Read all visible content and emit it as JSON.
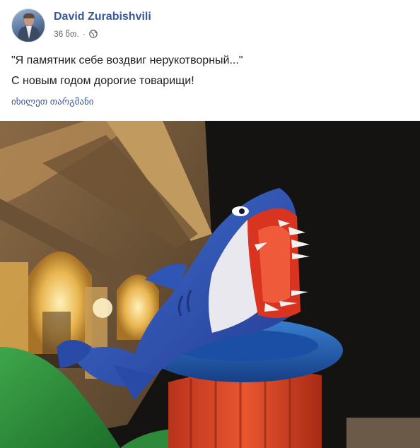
{
  "post": {
    "author_name": "David Zurabishvili",
    "timestamp": "36 წთ.",
    "separator": "·",
    "privacy_icon": "globe-icon",
    "lines": [
      "\"Я памятник себе воздвиг нерукотворный...\"",
      "С новым годом дорогие товарищи!"
    ],
    "translate_link": "იხილეთ თარგმანი"
  },
  "colors": {
    "link_blue": "#385898",
    "meta_gray": "#616770",
    "text": "#1c1e21"
  }
}
